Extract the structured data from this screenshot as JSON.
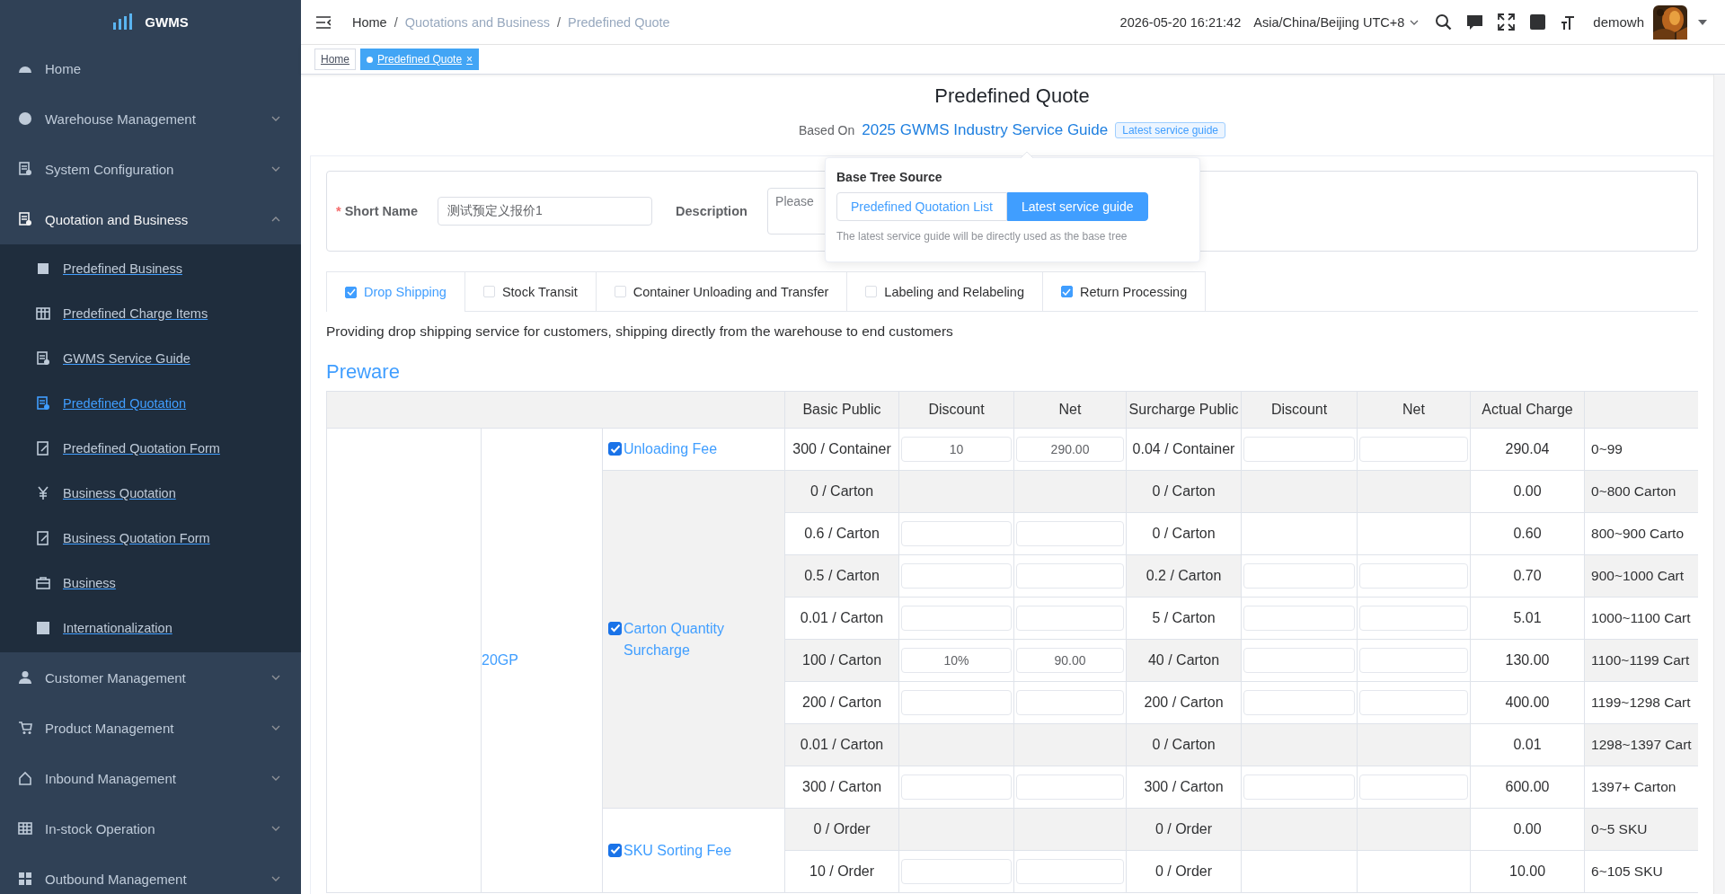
{
  "sidebar": {
    "logo": "GWMS",
    "items": [
      {
        "label": "Home"
      },
      {
        "label": "Warehouse Management",
        "expanded": false
      },
      {
        "label": "System Configuration",
        "expanded": false
      },
      {
        "label": "Quotation and Business",
        "expanded": true,
        "children": [
          {
            "label": "Predefined Business",
            "selected": false
          },
          {
            "label": "Predefined Charge Items",
            "selected": false
          },
          {
            "label": "GWMS Service Guide",
            "selected": false
          },
          {
            "label": "Predefined Quotation",
            "selected": true
          },
          {
            "label": "Predefined Quotation Form",
            "selected": false
          },
          {
            "label": "Business Quotation",
            "selected": false
          },
          {
            "label": "Business Quotation Form",
            "selected": false
          },
          {
            "label": "Business",
            "selected": false
          },
          {
            "label": "Internationalization",
            "selected": false
          }
        ]
      },
      {
        "label": "Customer Management",
        "expanded": false
      },
      {
        "label": "Product Management",
        "expanded": false
      },
      {
        "label": "Inbound Management",
        "expanded": false
      },
      {
        "label": "In-stock Operation",
        "expanded": false
      },
      {
        "label": "Outbound Management",
        "expanded": false
      }
    ]
  },
  "header": {
    "breadcrumb": [
      {
        "label": "Home"
      },
      {
        "separator": "/",
        "label": "Quotations and Business"
      },
      {
        "separator": "/",
        "label": "Predefined Quote"
      }
    ],
    "datetime": "2026-05-20 16:21:42",
    "timezone": "Asia/China/Beijing UTC+8",
    "username": "demowh"
  },
  "tags": [
    {
      "label": "Home",
      "selected": false
    },
    {
      "label": "Predefined Quote",
      "selected": true,
      "close": "×"
    }
  ],
  "page": {
    "title": "Predefined Quote",
    "based_on_label": "Based On",
    "based_on_link": "2025 GWMS Industry Service Guide",
    "based_on_tag": "Latest service guide"
  },
  "form": {
    "short_name": {
      "required_mark": "*",
      "label": "Short Name",
      "value": "测试预定义报价1"
    },
    "description": {
      "label": "Description",
      "placeholder": "Please"
    }
  },
  "popover": {
    "title": "Base Tree Source",
    "options": [
      {
        "label": "Predefined Quotation List",
        "selected": false
      },
      {
        "label": "Latest service guide",
        "selected": true
      }
    ],
    "hint": "The latest service guide will be directly used as the base tree"
  },
  "service_tabs": [
    {
      "label": "Drop Shipping",
      "checked": true,
      "selected": true
    },
    {
      "label": "Stock Transit",
      "checked": false,
      "selected": false
    },
    {
      "label": "Container Unloading and Transfer",
      "checked": false,
      "selected": false
    },
    {
      "label": "Labeling and Relabeling",
      "checked": false,
      "selected": false
    },
    {
      "label": "Return Processing",
      "checked": true,
      "selected": false
    }
  ],
  "service_description": "Providing drop shipping service for customers, shipping directly from the warehouse to end customers",
  "section_title": "Preware",
  "table": {
    "columns": [
      "Basic Public",
      "Discount",
      "Net",
      "Surcharge Public",
      "Discount",
      "Net",
      "Actual Charge"
    ],
    "category": "20GP",
    "groups": [
      {
        "name": "Unloading Fee",
        "checked": true,
        "rows": [
          {
            "basic": "300 / Container",
            "basic_editable": true,
            "basic_discount": "10",
            "basic_net": "290.00",
            "surcharge": "0.04 / Container",
            "surcharge_editable": true,
            "actual": "290.04",
            "range": "0~99"
          }
        ]
      },
      {
        "name": "Carton Quantity Surcharge",
        "checked": true,
        "rows": [
          {
            "basic": "0 / Carton",
            "basic_editable": false,
            "surcharge": "0 / Carton",
            "surcharge_editable": false,
            "actual": "0.00",
            "range": "0~800 Carton"
          },
          {
            "basic": "0.6 / Carton",
            "basic_editable": true,
            "surcharge": "0 / Carton",
            "surcharge_editable": false,
            "actual": "0.60",
            "range": "800~900 Carto"
          },
          {
            "basic": "0.5 / Carton",
            "basic_editable": true,
            "surcharge": "0.2 / Carton",
            "surcharge_editable": true,
            "actual": "0.70",
            "range": "900~1000 Cart"
          },
          {
            "basic": "0.01 / Carton",
            "basic_editable": true,
            "surcharge": "5 / Carton",
            "surcharge_editable": true,
            "actual": "5.01",
            "range": "1000~1100 Cart"
          },
          {
            "basic": "100 / Carton",
            "basic_editable": true,
            "basic_discount": "10%",
            "basic_net": "90.00",
            "surcharge": "40 / Carton",
            "surcharge_editable": true,
            "actual": "130.00",
            "range": "1100~1199 Cart"
          },
          {
            "basic": "200 / Carton",
            "basic_editable": true,
            "surcharge": "200 / Carton",
            "surcharge_editable": true,
            "actual": "400.00",
            "range": "1199~1298 Cart"
          },
          {
            "basic": "0.01 / Carton",
            "basic_editable": false,
            "surcharge": "0 / Carton",
            "surcharge_editable": false,
            "actual": "0.01",
            "range": "1298~1397 Cart"
          },
          {
            "basic": "300 / Carton",
            "basic_editable": true,
            "surcharge": "300 / Carton",
            "surcharge_editable": true,
            "actual": "600.00",
            "range": "1397+ Carton"
          }
        ]
      },
      {
        "name": "SKU Sorting Fee",
        "checked": true,
        "rows": [
          {
            "basic": "0 / Order",
            "basic_editable": false,
            "surcharge": "0 / Order",
            "surcharge_editable": false,
            "actual": "0.00",
            "range": "0~5 SKU"
          },
          {
            "basic": "10 / Order",
            "basic_editable": true,
            "surcharge": "0 / Order",
            "surcharge_editable": false,
            "actual": "10.00",
            "range": "6~105 SKU"
          }
        ]
      }
    ]
  }
}
